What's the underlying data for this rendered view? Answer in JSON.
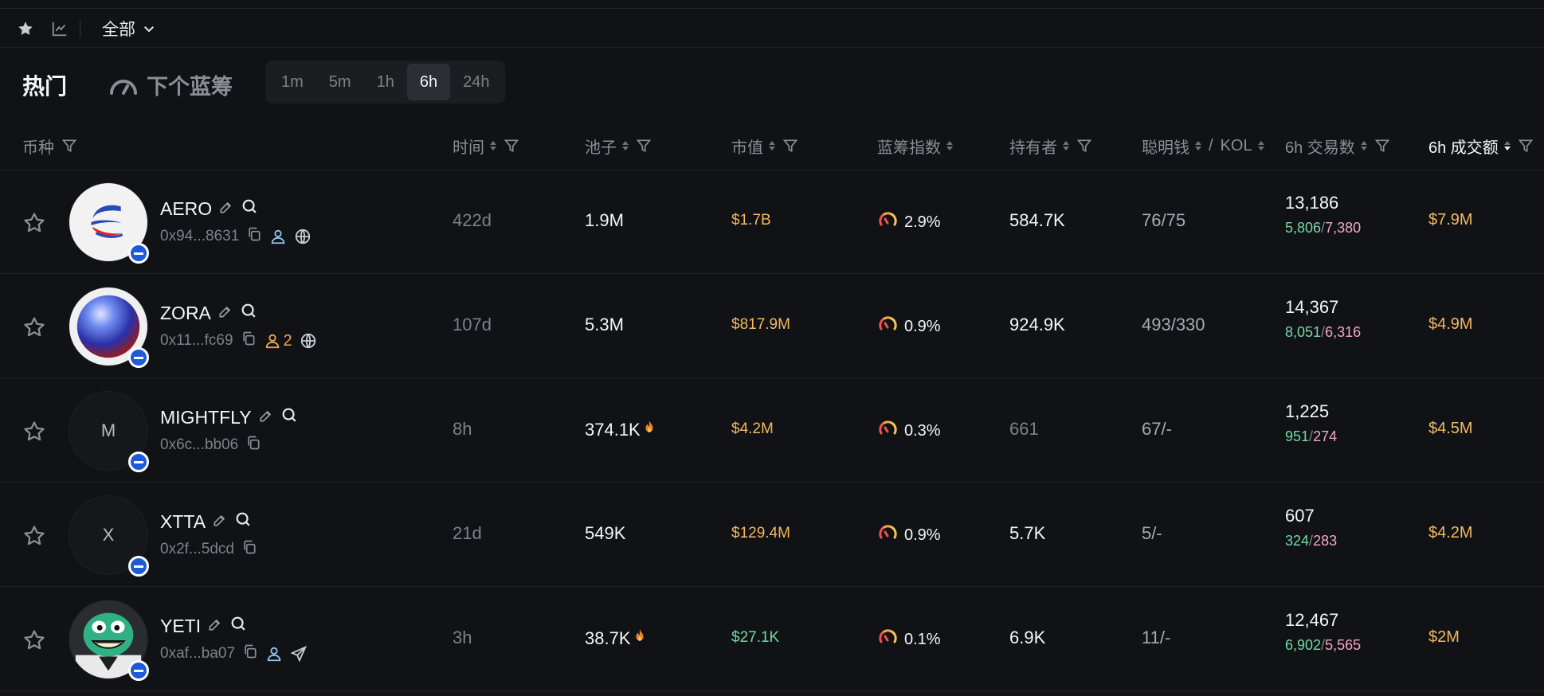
{
  "toolbar": {
    "filter_label": "全部"
  },
  "tabs": {
    "hot": "热门",
    "next_bluechip": "下个蓝筹",
    "timeframes": [
      "1m",
      "5m",
      "1h",
      "6h",
      "24h"
    ],
    "active_timeframe": "6h"
  },
  "columns": {
    "token": "币种",
    "age": "时间",
    "pool": "池子",
    "mcap": "市值",
    "bluechip": "蓝筹指数",
    "holders": "持有者",
    "smart": "聪明钱",
    "smart_sep": "/",
    "kol": "KOL",
    "txs": "6h 交易数",
    "volume": "6h 成交额"
  },
  "rows": [
    {
      "name": "AERO",
      "address": "0x94...8631",
      "age": "422d",
      "pool": "1.9M",
      "pool_hot": false,
      "mcap": "$1.7B",
      "bluechip": "2.9%",
      "holders": "584.7K",
      "smart_kol": "76/75",
      "txs": "13,186",
      "buys": "5,806",
      "sells": "7,380",
      "volume": "$7.9M",
      "avatar_letter": "",
      "holder_count": ""
    },
    {
      "name": "ZORA",
      "address": "0x11...fc69",
      "age": "107d",
      "pool": "5.3M",
      "pool_hot": false,
      "mcap": "$817.9M",
      "bluechip": "0.9%",
      "holders": "924.9K",
      "smart_kol": "493/330",
      "txs": "14,367",
      "buys": "8,051",
      "sells": "6,316",
      "volume": "$4.9M",
      "avatar_letter": "",
      "holder_count": "2"
    },
    {
      "name": "MIGHTFLY",
      "address": "0x6c...bb06",
      "age": "8h",
      "pool": "374.1K",
      "pool_hot": true,
      "mcap": "$4.2M",
      "bluechip": "0.3%",
      "holders": "661",
      "smart_kol": "67/-",
      "txs": "1,225",
      "buys": "951",
      "sells": "274",
      "volume": "$4.5M",
      "avatar_letter": "M",
      "holder_count": ""
    },
    {
      "name": "XTTA",
      "address": "0x2f...5dcd",
      "age": "21d",
      "pool": "549K",
      "pool_hot": false,
      "mcap": "$129.4M",
      "bluechip": "0.9%",
      "holders": "5.7K",
      "smart_kol": "5/-",
      "txs": "607",
      "buys": "324",
      "sells": "283",
      "volume": "$4.2M",
      "avatar_letter": "X",
      "holder_count": ""
    },
    {
      "name": "YETI",
      "address": "0xaf...ba07",
      "age": "3h",
      "pool": "38.7K",
      "pool_hot": true,
      "mcap": "$27.1K",
      "bluechip": "0.1%",
      "holders": "6.9K",
      "smart_kol": "11/-",
      "txs": "12,467",
      "buys": "6,902",
      "sells": "5,565",
      "volume": "$2M",
      "avatar_letter": "",
      "holder_count": ""
    }
  ],
  "colors": {
    "bg": "#111215",
    "buy": "#74d8a6",
    "sell": "#f3a7bd",
    "mcap": "#f3b95f",
    "mcap_low": "#74d8a6",
    "badge": "#1d5bd8"
  }
}
